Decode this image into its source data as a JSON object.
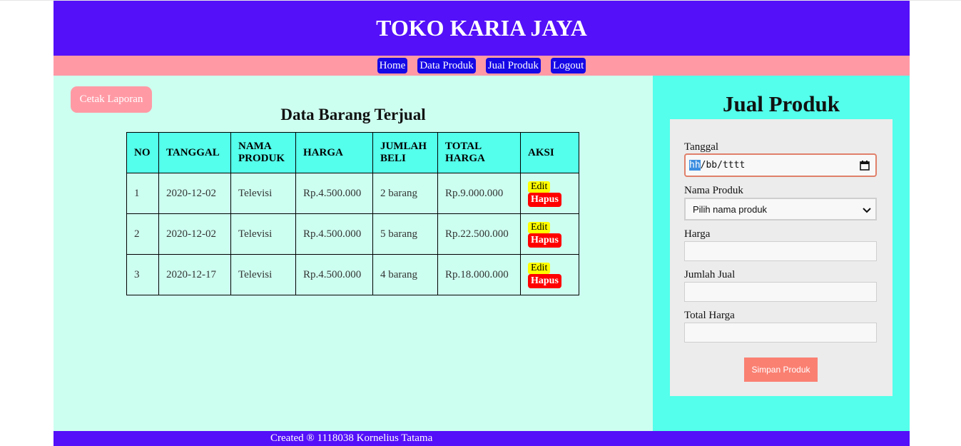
{
  "header": {
    "title": "TOKO KARIA JAYA"
  },
  "nav": {
    "items": [
      "Home",
      "Data Produk",
      "Jual Produk",
      "Logout"
    ]
  },
  "left": {
    "print_button": "Cetak Laporan",
    "table_title": "Data Barang Terjual",
    "columns": [
      "NO",
      "TANGGAL",
      "NAMA PRODUK",
      "HARGA",
      "JUMLAH BELI",
      "TOTAL HARGA",
      "AKSI"
    ],
    "rows": [
      {
        "no": "1",
        "tanggal": "2020-12-02",
        "nama": "Televisi",
        "harga": "Rp.4.500.000",
        "jumlah": "2 barang",
        "total": "Rp.9.000.000",
        "edit": "Edit",
        "hapus": "Hapus"
      },
      {
        "no": "2",
        "tanggal": "2020-12-02",
        "nama": "Televisi",
        "harga": "Rp.4.500.000",
        "jumlah": "5 barang",
        "total": "Rp.22.500.000",
        "edit": "Edit",
        "hapus": "Hapus"
      },
      {
        "no": "3",
        "tanggal": "2020-12-17",
        "nama": "Televisi",
        "harga": "Rp.4.500.000",
        "jumlah": "4 barang",
        "total": "Rp.18.000.000",
        "edit": "Edit",
        "hapus": "Hapus"
      }
    ]
  },
  "form": {
    "title": "Jual Produk",
    "tanggal_label": "Tanggal",
    "tanggal_placeholder_hh": "hh",
    "tanggal_placeholder_rest": "/bb/tttt",
    "nama_label": "Nama Produk",
    "nama_selected": "Pilih nama produk",
    "harga_label": "Harga",
    "harga_value": "",
    "jumlah_label": "Jumlah Jual",
    "jumlah_value": "",
    "total_label": "Total Harga",
    "total_value": "",
    "submit_label": "Simpan Produk"
  },
  "footer": {
    "text": "Created ® 1118038 Kornelius Tatama"
  },
  "colors": {
    "header_bg": "#5410f8",
    "nav_bg": "#ff9aa5",
    "nav_button": "#1608e6",
    "left_bg": "#cdfff0",
    "right_bg": "#54ffeb",
    "table_header_bg": "#54ffeb",
    "edit_bg": "#ffff00",
    "hapus_bg": "#ff0000",
    "submit_bg": "#fa8072"
  },
  "icons": {
    "date_field": "calendar-icon",
    "select_field": "chevron-down-icon"
  }
}
